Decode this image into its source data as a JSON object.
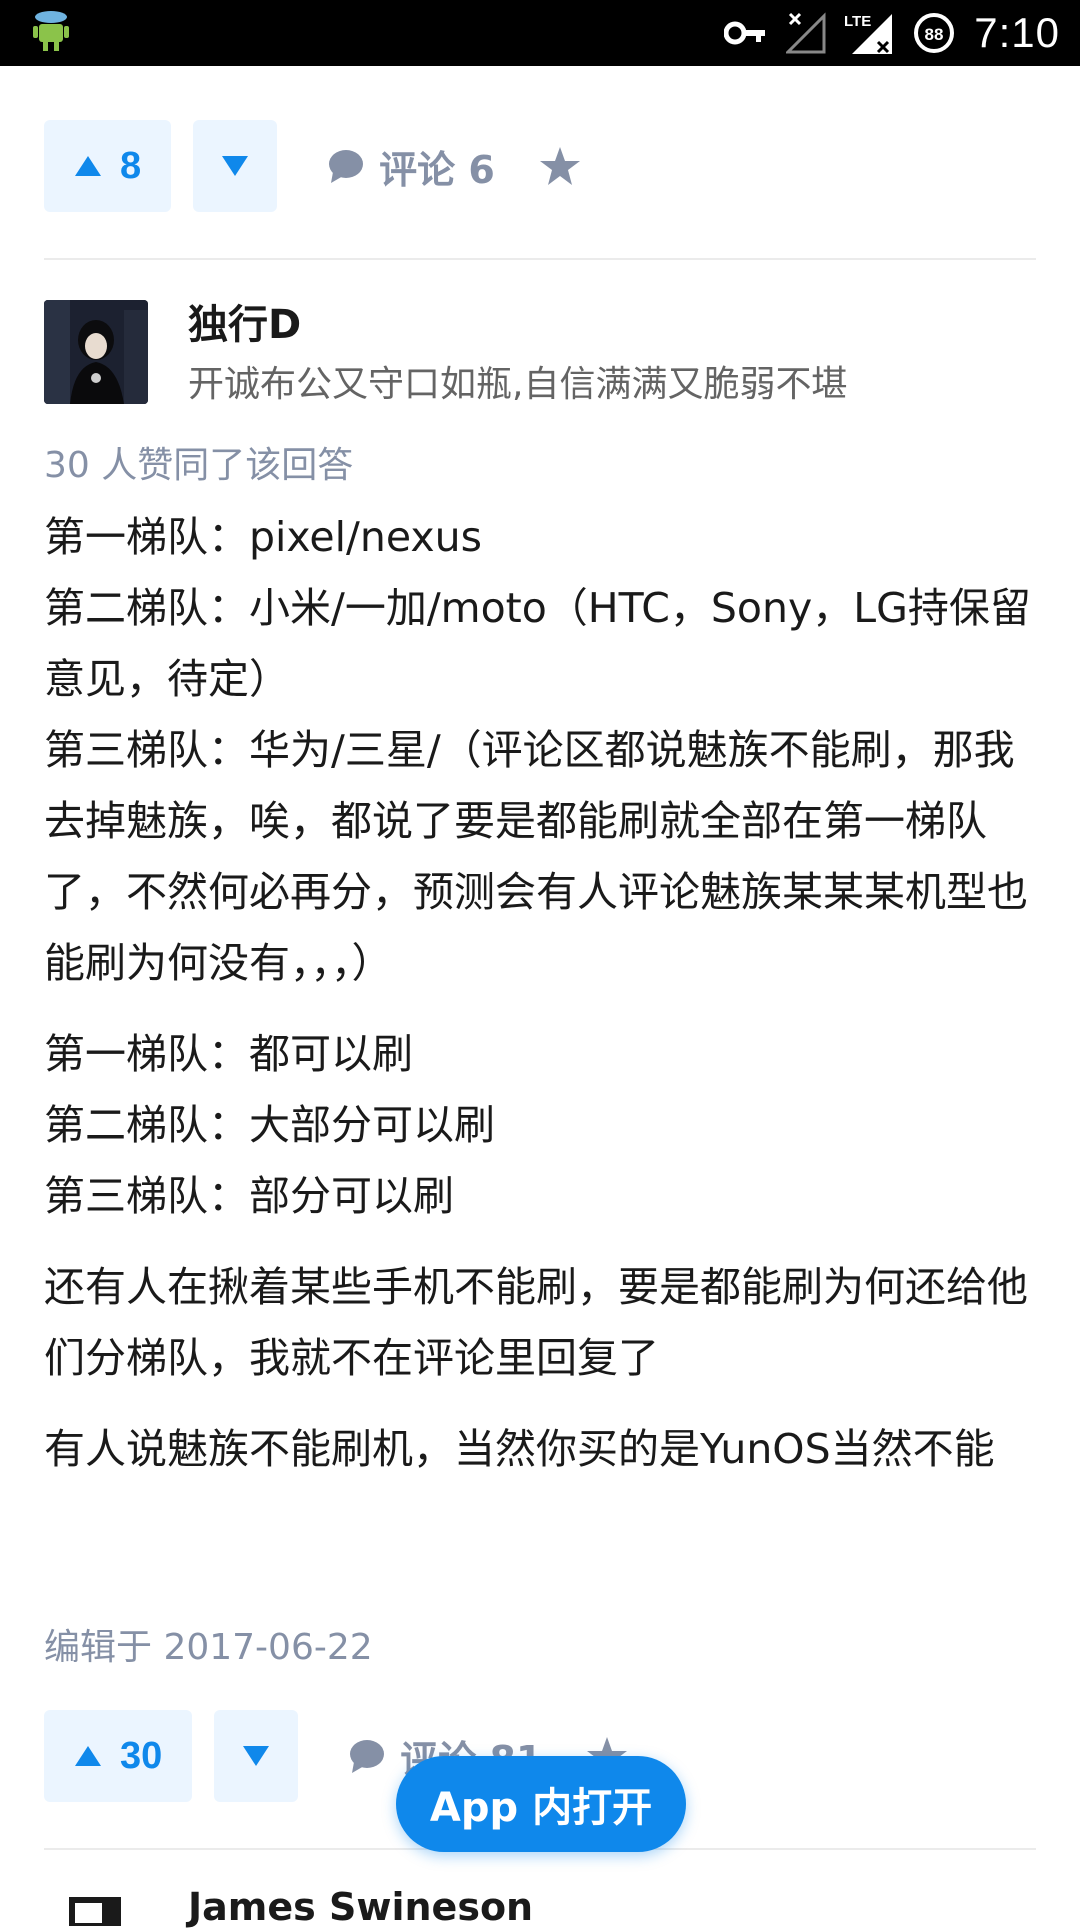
{
  "status_bar": {
    "time": "7:10",
    "battery": "88",
    "network": "LTE",
    "icons": [
      "android-debug-icon",
      "vpn-key-icon",
      "signal-off-icon",
      "lte-signal-icon",
      "battery-saver-icon"
    ]
  },
  "prev_answer_actions": {
    "upvote_count": "8",
    "comment_label": "评论 6"
  },
  "answer": {
    "author_name": "独行D",
    "author_bio": "开诚布公又守口如瓶,自信满满又脆弱不堪",
    "votes_text": "30 人赞同了该回答",
    "paragraphs": [
      [
        "第一梯队：pixel/nexus",
        "第二梯队：小米/一加/moto（HTC，Sony，LG持保留意见，待定）",
        "第三梯队：华为/三星/（评论区都说魅族不能刷，那我去掉魅族，唉，都说了要是都能刷就全部在第一梯队了，不然何必再分，预测会有人评论魅族某某某机型也能刷为何没有，，，）"
      ],
      [
        "第一梯队：都可以刷",
        "第二梯队：大部分可以刷",
        "第三梯队：部分可以刷"
      ],
      [
        "还有人在揪着某些手机不能刷，要是都能刷为何还给他们分梯队，我就不在评论里回复了"
      ],
      [
        "有人说魅族不能刷机，当然你买的是YunOS当然不能"
      ]
    ],
    "edited": "编辑于 2017-06-22",
    "upvote_count": "30",
    "comment_label": "评论 81"
  },
  "next_answer": {
    "author_name": "James Swineson"
  },
  "open_in_app_label": "App 内打开",
  "colors": {
    "accent": "#0f88eb",
    "vote_bg": "#ebf5ff",
    "muted": "#8590a6"
  }
}
